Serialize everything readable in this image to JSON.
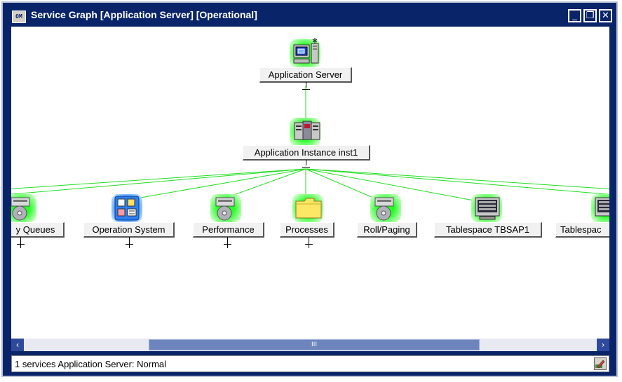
{
  "window": {
    "title": "Service Graph [Application Server] [Operational]",
    "app_icon_text": "OM",
    "buttons": {
      "minimize": "_",
      "restore": "❐",
      "close": "✕"
    }
  },
  "graph": {
    "root": {
      "label": "Application Server",
      "icon": "server-icon",
      "status": "Normal"
    },
    "instance": {
      "label": "Application Instance inst1",
      "icon": "instance-icon",
      "status": "Normal"
    },
    "children": [
      {
        "label": "y Queues",
        "icon": "disk-icon",
        "status": "Normal"
      },
      {
        "label": "Operation System",
        "icon": "os-icon",
        "status": "Unknown"
      },
      {
        "label": "Performance",
        "icon": "disk-icon",
        "status": "Normal"
      },
      {
        "label": "Processes",
        "icon": "folder-icon",
        "status": "Normal"
      },
      {
        "label": "Roll/Paging",
        "icon": "disk-icon",
        "status": "Normal"
      },
      {
        "label": "Tablespace TBSAP1",
        "icon": "tablespace-icon",
        "status": "Normal"
      },
      {
        "label": "Tablespac",
        "icon": "tablespace-icon",
        "status": "Normal"
      }
    ],
    "colors": {
      "normal": "#28ff28",
      "unknown": "#2c8cff",
      "edge": "#22dd22"
    }
  },
  "scrollbar": {
    "left_arrow": "‹",
    "right_arrow": "›",
    "thumb_grip": "III"
  },
  "status": {
    "text": "1 services  Application Server: Normal"
  }
}
